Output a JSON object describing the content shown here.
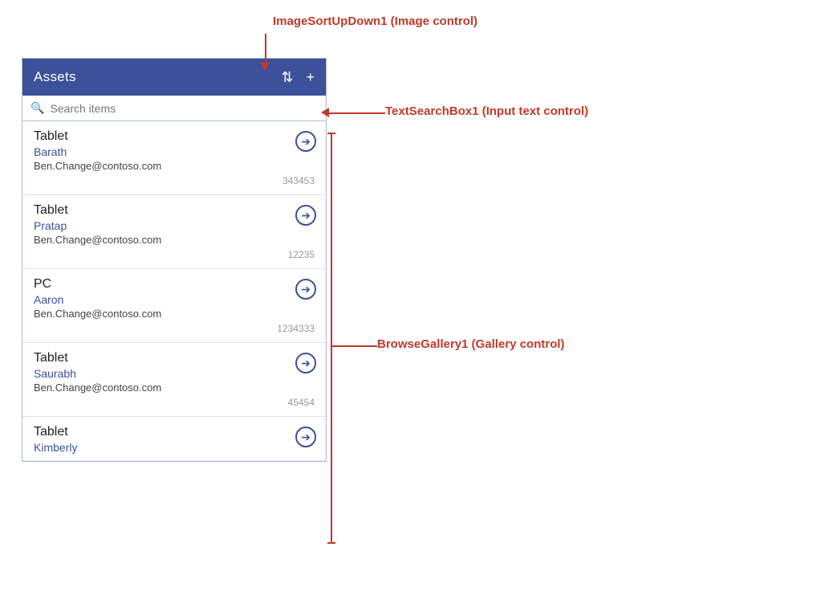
{
  "header": {
    "title": "Assets",
    "sort_icon": "⇅",
    "add_icon": "+"
  },
  "search": {
    "placeholder": "Search items"
  },
  "gallery": {
    "items": [
      {
        "type": "Tablet",
        "owner": "Barath",
        "email": "Ben.Change@contoso.com",
        "id": "343453"
      },
      {
        "type": "Tablet",
        "owner": "Pratap",
        "email": "Ben.Change@contoso.com",
        "id": "12235"
      },
      {
        "type": "PC",
        "owner": "Aaron",
        "email": "Ben.Change@contoso.com",
        "id": "1234333"
      },
      {
        "type": "Tablet",
        "owner": "Saurabh",
        "email": "Ben.Change@contoso.com",
        "id": "45454"
      },
      {
        "type": "Tablet",
        "owner": "Kimberly",
        "email": "",
        "id": ""
      }
    ]
  },
  "annotations": {
    "sort_label": "ImageSortUpDown1 (Image control)",
    "search_label": "TextSearchBox1 (Input text control)",
    "gallery_label": "BrowseGallery1 (Gallery control)"
  }
}
